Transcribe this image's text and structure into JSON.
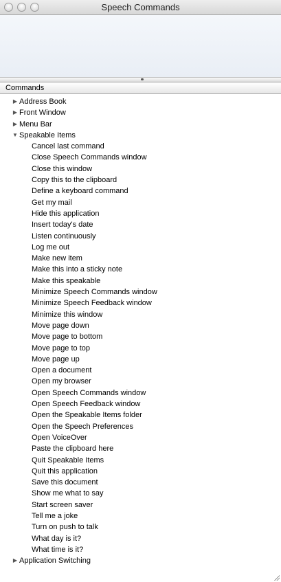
{
  "window": {
    "title": "Speech Commands"
  },
  "header": {
    "column_label": "Commands"
  },
  "groups": [
    {
      "label": "Address Book",
      "expanded": false
    },
    {
      "label": "Front Window",
      "expanded": false
    },
    {
      "label": "Menu Bar",
      "expanded": false
    },
    {
      "label": "Speakable Items",
      "expanded": true,
      "items": [
        "Cancel last command",
        "Close Speech Commands window",
        "Close this window",
        "Copy this to the clipboard",
        "Define a keyboard command",
        "Get my mail",
        "Hide this application",
        "Insert today's date",
        "Listen continuously",
        "Log me out",
        "Make new item",
        "Make this into a sticky note",
        "Make this speakable",
        "Minimize Speech Commands window",
        "Minimize Speech Feedback window",
        "Minimize this window",
        "Move page down",
        "Move page to bottom",
        "Move page to top",
        "Move page up",
        "Open a document",
        "Open my browser",
        "Open Speech Commands window",
        "Open Speech Feedback window",
        "Open the Speakable Items folder",
        "Open the Speech Preferences",
        "Open VoiceOver",
        "Paste the clipboard here",
        "Quit Speakable Items",
        "Quit this application",
        "Save this document",
        "Show me what to say",
        "Start screen saver",
        "Tell me a joke",
        "Turn on push to talk",
        "What day is it?",
        "What time is it?"
      ]
    },
    {
      "label": "Application Switching",
      "expanded": false
    }
  ],
  "icons": {
    "collapsed": "disclosure-triangle-right-icon",
    "expanded": "disclosure-triangle-down-icon"
  }
}
